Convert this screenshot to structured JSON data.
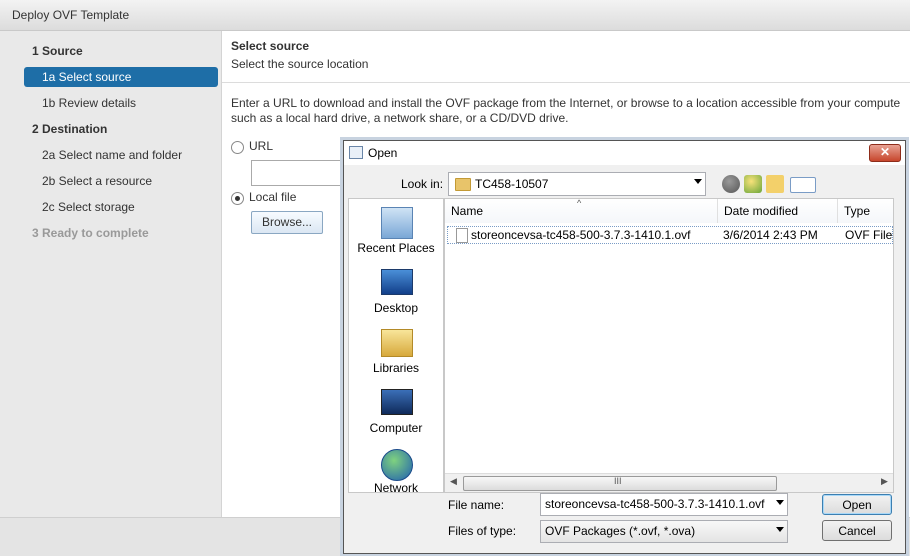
{
  "window": {
    "title": "Deploy OVF Template"
  },
  "steps": [
    {
      "label": "1  Source",
      "state": "header"
    },
    {
      "label": "1a  Select source",
      "state": "selected"
    },
    {
      "label": "1b  Review details",
      "state": "normal"
    },
    {
      "label": "2  Destination",
      "state": "header"
    },
    {
      "label": "2a  Select name and folder",
      "state": "normal"
    },
    {
      "label": "2b  Select a resource",
      "state": "normal"
    },
    {
      "label": "2c  Select storage",
      "state": "normal"
    },
    {
      "label": "3  Ready to complete",
      "state": "disabled"
    }
  ],
  "main": {
    "title": "Select source",
    "subtitle": "Select the source location",
    "description_line1": "Enter a URL to download and install the OVF package from the Internet, or browse to a location accessible from your compute",
    "description_line2": "such as a local hard drive, a network share, or a CD/DVD drive.",
    "url_label": "URL",
    "local_label": "Local file",
    "browse_label": "Browse...",
    "selected_option": "Local file"
  },
  "open_dialog": {
    "title": "Open",
    "close_symbol": "✕",
    "look_in_label": "Look in:",
    "look_in_value": "TC458-10507",
    "places": [
      {
        "label": "Recent Places",
        "icon": "recent-places-icon"
      },
      {
        "label": "Desktop",
        "icon": "desktop-icon"
      },
      {
        "label": "Libraries",
        "icon": "libraries-icon"
      },
      {
        "label": "Computer",
        "icon": "computer-icon"
      },
      {
        "label": "Network",
        "icon": "network-icon"
      }
    ],
    "columns": {
      "name": "Name",
      "date": "Date modified",
      "type": "Type"
    },
    "files": [
      {
        "name": "storeoncevsa-tc458-500-3.7.3-1410.1.ovf",
        "date": "3/6/2014 2:43 PM",
        "type": "OVF File"
      }
    ],
    "scroll_grip": "III",
    "file_name_label": "File name:",
    "file_name_value": "storeoncevsa-tc458-500-3.7.3-1410.1.ovf",
    "files_of_type_label": "Files of type:",
    "files_of_type_value": "OVF Packages (*.ovf, *.ova)",
    "open_button": "Open",
    "cancel_button": "Cancel"
  }
}
